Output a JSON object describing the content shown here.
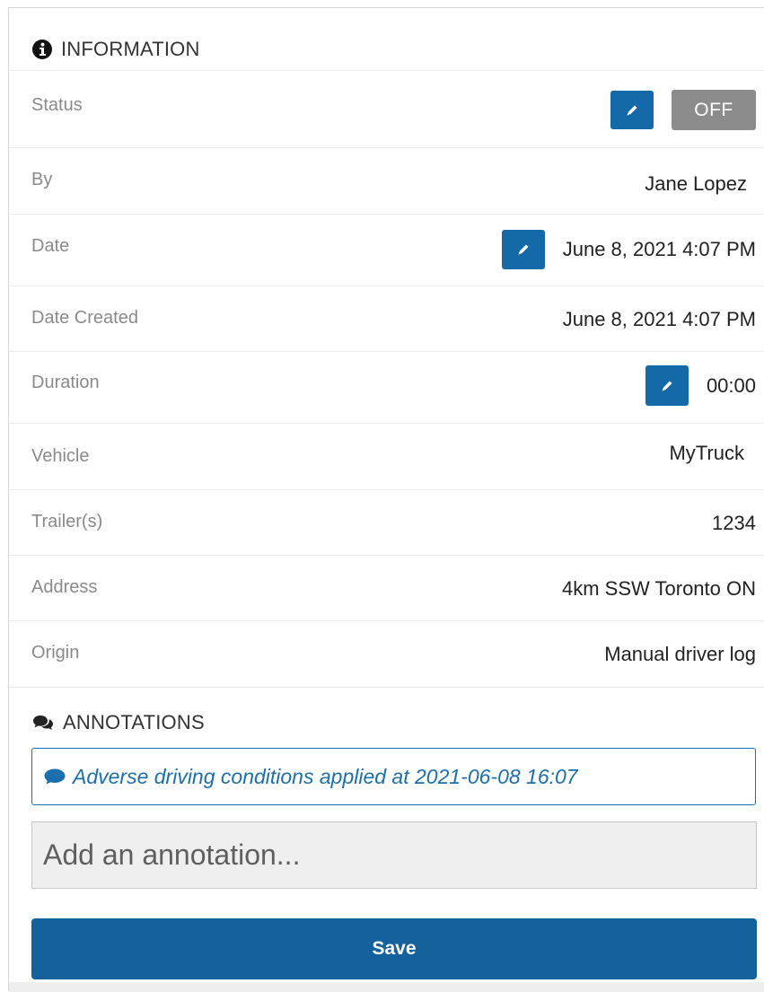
{
  "information": {
    "title": "INFORMATION",
    "icon": "info-circle-icon"
  },
  "rows": {
    "status": {
      "label": "Status",
      "value": "OFF"
    },
    "by": {
      "label": "By",
      "value": "Jane Lopez"
    },
    "date": {
      "label": "Date",
      "value": "June 8, 2021 4:07 PM"
    },
    "date_created": {
      "label": "Date Created",
      "value": "June 8, 2021 4:07 PM"
    },
    "duration": {
      "label": "Duration",
      "value": "00:00"
    },
    "vehicle": {
      "label": "Vehicle",
      "value": "MyTruck"
    },
    "trailers": {
      "label": "Trailer(s)",
      "value": "1234"
    },
    "address": {
      "label": "Address",
      "value": "4km SSW Toronto ON"
    },
    "origin": {
      "label": "Origin",
      "value": "Manual driver log"
    }
  },
  "annotations": {
    "title": "ANNOTATIONS",
    "icon": "comments-icon",
    "items": [
      "Adverse driving conditions applied at 2021-06-08 16:07"
    ],
    "input_placeholder": "Add an annotation...",
    "input_value": ""
  },
  "save_label": "Save",
  "colors": {
    "accent": "#1469a8",
    "off_badge": "#8c8c8c",
    "annotation_text": "#1b6fae",
    "label_text": "#8a8a8a"
  }
}
